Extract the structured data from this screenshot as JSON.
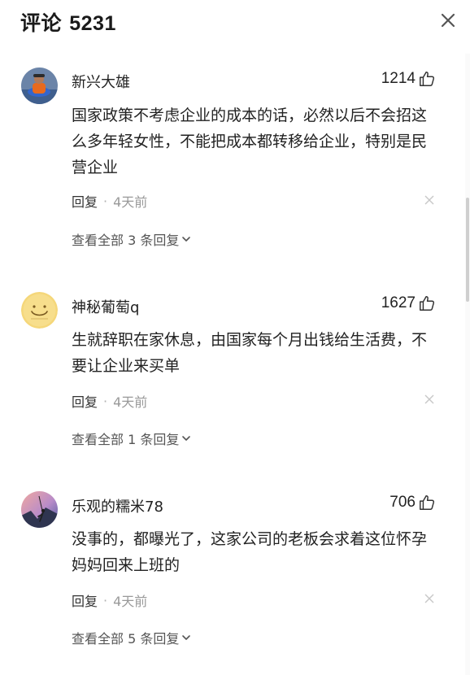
{
  "header": {
    "title": "评论",
    "count": "5231"
  },
  "comments": [
    {
      "username": "新兴大雄",
      "likes": "1214",
      "text": "国家政策不考虑企业的成本的话，必然以后不会招这么多年轻女性，不能把成本都转移给企业，特别是民营企业",
      "reply_label": "回复",
      "separator": "·",
      "time": "4天前",
      "view_all": "查看全部 3 条回复",
      "avatar_icon": "person-photo-avatar"
    },
    {
      "username": "神秘葡萄q",
      "likes": "1627",
      "text": "生就辞职在家休息，由国家每个月出钱给生活费，不要让企业来买单",
      "reply_label": "回复",
      "separator": "·",
      "time": "4天前",
      "view_all": "查看全部 1 条回复",
      "avatar_icon": "smiley-face-avatar"
    },
    {
      "username": "乐观的糯米78",
      "likes": "706",
      "text": "没事的，都曝光了，这家公司的老板会求着这位怀孕妈妈回来上班的",
      "reply_label": "回复",
      "separator": "·",
      "time": "4天前",
      "view_all": "查看全部 5 条回复",
      "avatar_icon": "climber-photo-avatar"
    }
  ],
  "colors": {
    "text": "#222222",
    "muted": "#999999",
    "background": "#ffffff"
  }
}
